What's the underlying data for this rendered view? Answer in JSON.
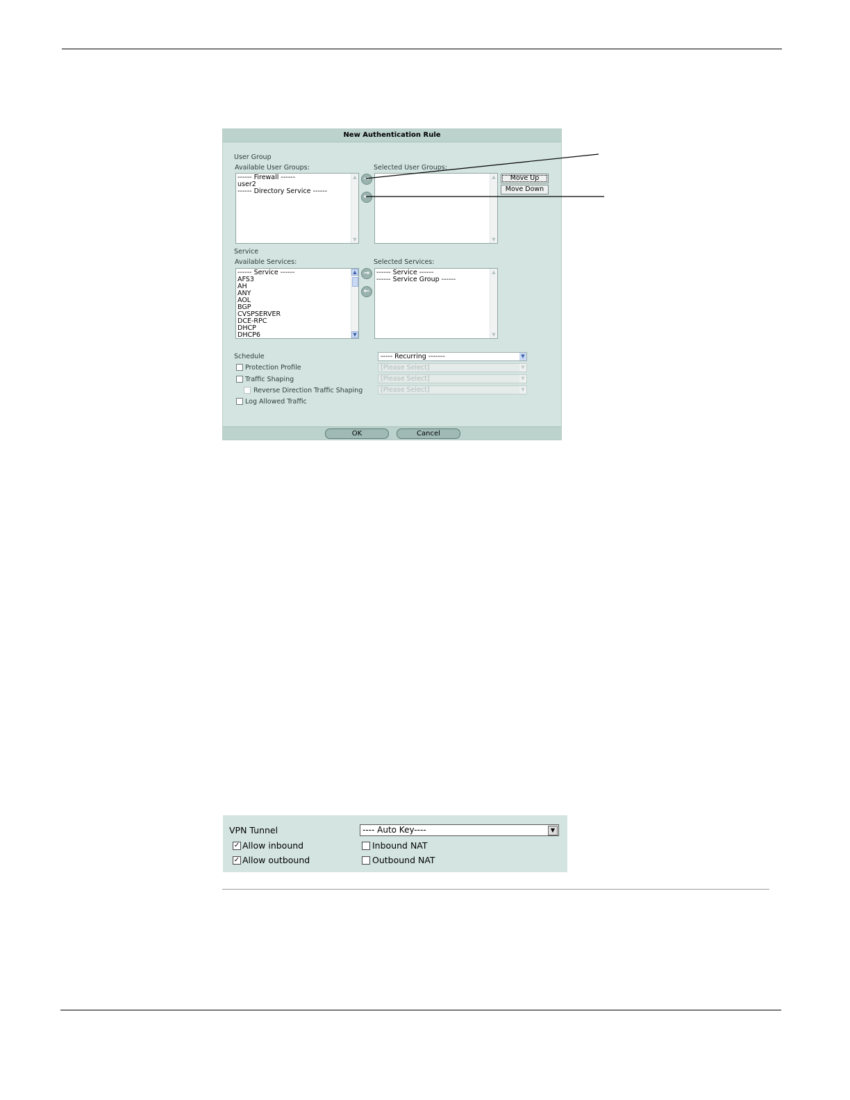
{
  "dialog": {
    "title": "New Authentication Rule",
    "user_group_section": "User Group",
    "available_user_groups_label": "Available User Groups:",
    "selected_user_groups_label": "Selected User Groups:",
    "available_user_groups": "------ Firewall ------\nuser2\n------ Directory Service ------",
    "selected_user_groups": "",
    "move_up_label": "Move Up",
    "move_down_label": "Move Down",
    "service_section": "Service",
    "available_services_label": "Available Services:",
    "selected_services_label": "Selected Services:",
    "available_services": "------ Service ------\nAFS3\nAH\nANY\nAOL\nBGP\nCVSPSERVER\nDCE-RPC\nDHCP\nDHCP6",
    "selected_services": "------ Service ------\n------ Service Group ------",
    "schedule_label": "Schedule",
    "schedule_value": "----- Recurring -------",
    "protection_profile_label": "Protection Profile",
    "protection_profile_value": "[Please Select]",
    "traffic_shaping_label": "Traffic Shaping",
    "traffic_shaping_value": "[Please Select]",
    "reverse_shaping_label": "Reverse Direction Traffic Shaping",
    "reverse_shaping_value": "[Please Select]",
    "log_allowed_label": "Log Allowed Traffic",
    "ok_label": "OK",
    "cancel_label": "Cancel",
    "add_arrow_glyph": "→",
    "remove_arrow_glyph": "←"
  },
  "vpn": {
    "tunnel_label": "VPN Tunnel",
    "tunnel_value": "---- Auto Key----",
    "allow_inbound_label": "Allow inbound",
    "allow_inbound_checked": true,
    "allow_outbound_label": "Allow outbound",
    "allow_outbound_checked": true,
    "inbound_nat_label": "Inbound NAT",
    "inbound_nat_checked": false,
    "outbound_nat_label": "Outbound NAT",
    "outbound_nat_checked": false,
    "check_glyph": "✓"
  },
  "colors": {
    "panel_bg": "#d3e4e1",
    "title_bar": "#bcd2cd"
  }
}
